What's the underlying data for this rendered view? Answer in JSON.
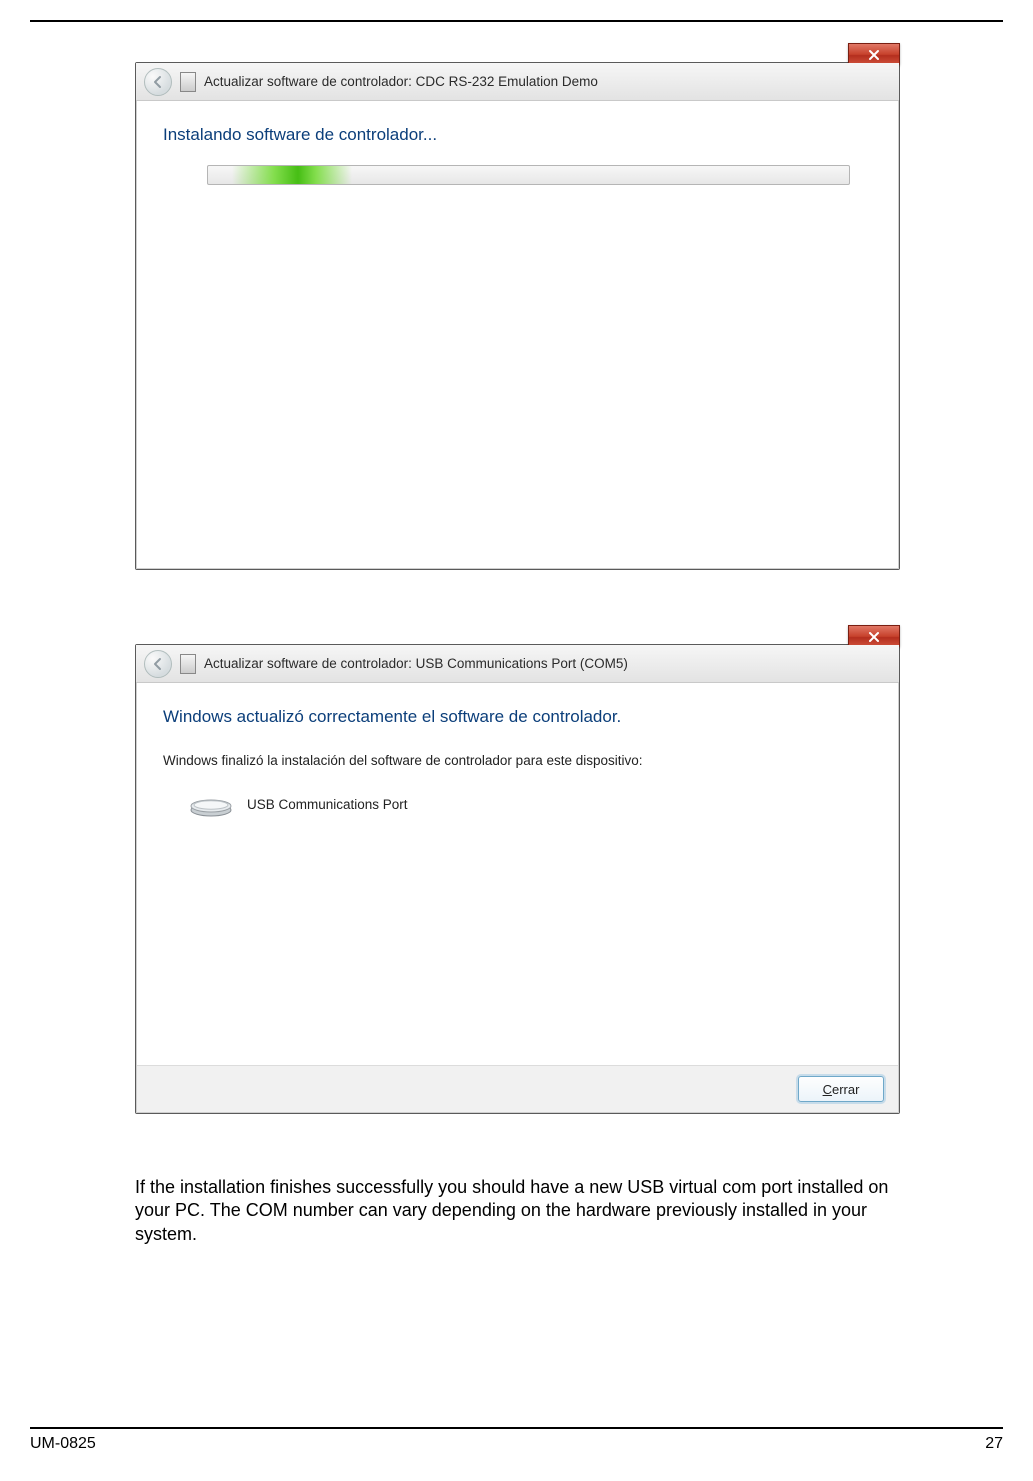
{
  "dialog1": {
    "title": "Actualizar software de controlador: CDC RS-232 Emulation Demo",
    "heading": "Instalando software de controlador...",
    "progress_state": "indeterminate"
  },
  "dialog2": {
    "title": "Actualizar software de controlador: USB Communications Port (COM5)",
    "heading": "Windows actualizó correctamente el software de controlador.",
    "subtext": "Windows finalizó la instalación del software de controlador para este dispositivo:",
    "device_name": "USB Communications Port",
    "close_button": "Cerrar"
  },
  "caption": "If the installation finishes successfully you should have a new USB virtual com port installed on your PC. The COM number can vary depending on the hardware previously installed in your system.",
  "footer": {
    "doc_id": "UM-0825",
    "page_number": "27"
  },
  "colors": {
    "heading_blue": "#0b3e7a",
    "close_red": "#c6402b"
  }
}
